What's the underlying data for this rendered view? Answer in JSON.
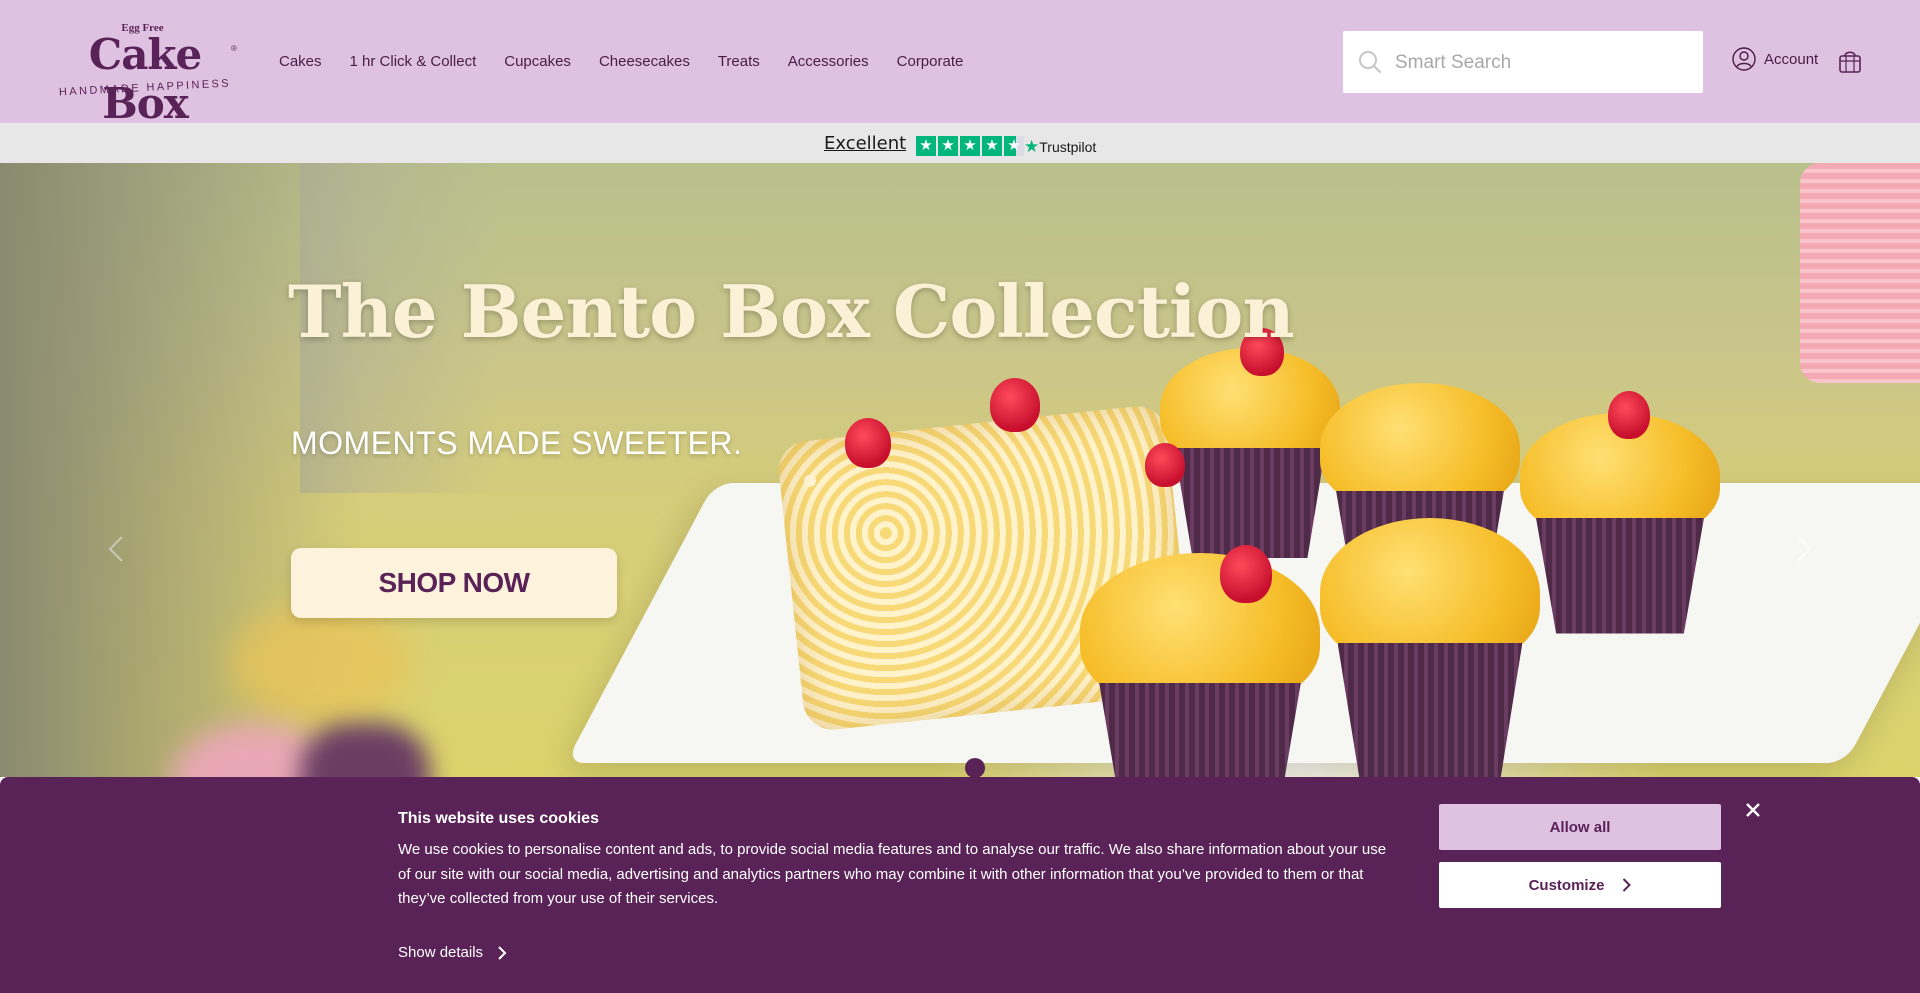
{
  "logo": {
    "small_text": "Egg Free",
    "main_text": "Cake Box",
    "registered": "®",
    "tagline": "HANDMADE HAPPINESS"
  },
  "nav": {
    "items": [
      {
        "label": "Cakes"
      },
      {
        "label": "1 hr Click & Collect"
      },
      {
        "label": "Cupcakes"
      },
      {
        "label": "Cheesecakes"
      },
      {
        "label": "Treats"
      },
      {
        "label": "Accessories"
      },
      {
        "label": "Corporate"
      }
    ]
  },
  "search": {
    "placeholder": "Smart Search",
    "icon": "search-icon"
  },
  "account": {
    "label": "Account",
    "icon": "user-icon"
  },
  "basket": {
    "icon": "basket-icon"
  },
  "trustpilot": {
    "rating_text": "Excellent",
    "brand": "Trustpilot",
    "stars": 4.5,
    "accent_color": "#00b67a"
  },
  "hero": {
    "title": "The Bento Box Collection",
    "subtitle": "MOMENTS MADE SWEETER.",
    "cta_label": "SHOP NOW",
    "prev_icon": "chevron-left-icon",
    "next_icon": "chevron-right-icon",
    "slide_count": 1,
    "active_slide": 1
  },
  "cookie_banner": {
    "title": "This website uses cookies",
    "text": "We use cookies to personalise content and ads, to provide social media features and to analyse our traffic. We also share information about your use of our site with our social media, advertising and analytics partners who may combine it with other information that you’ve provided to them or that they’ve collected from your use of their services.",
    "show_details_label": "Show details",
    "allow_all_label": "Allow all",
    "customize_label": "Customize",
    "close_icon": "close-icon"
  },
  "colors": {
    "header_bg": "#dfc1e1",
    "brand_purple": "#5a2358",
    "trustbar_bg": "#e7e7e7",
    "cta_bg": "#fdf3dc"
  }
}
